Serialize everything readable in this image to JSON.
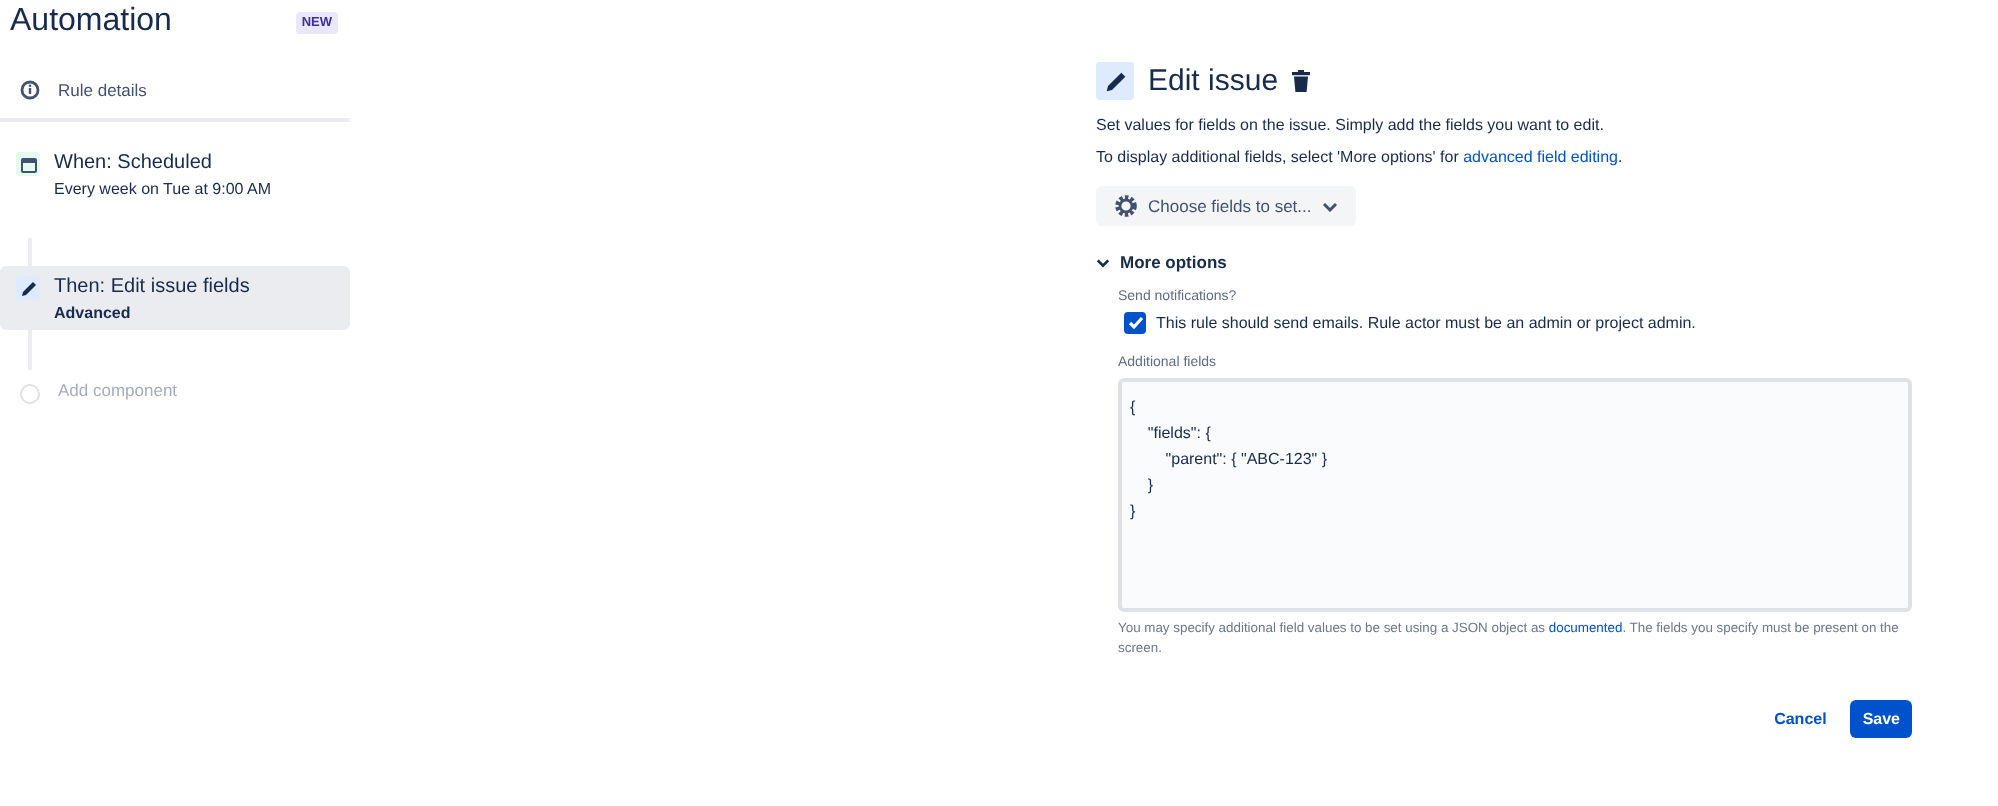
{
  "sidebar": {
    "title": "Automation",
    "badge": "NEW",
    "rule_details": "Rule details",
    "steps": [
      {
        "kind": "trigger",
        "title": "When: Scheduled",
        "subtitle": "Every week on Tue at 9:00 AM",
        "selected": false
      },
      {
        "kind": "action",
        "title": "Then: Edit issue fields",
        "subtitle": "Advanced",
        "selected": true
      },
      {
        "kind": "add",
        "title": "Add component",
        "selected": false
      }
    ]
  },
  "panel": {
    "title": "Edit issue",
    "description": "Set values for fields on the issue. Simply add the fields you want to edit.",
    "hint": {
      "before": "To display additional fields, select 'More options' for ",
      "link": "advanced field editing",
      "after": "."
    },
    "choose_button": "Choose fields to set...",
    "more_options": {
      "label": "More options",
      "expanded": true,
      "notifications_label": "Send notifications?",
      "notify": {
        "label": "This rule should send emails. Rule actor must be an admin or project admin.",
        "checked": true
      },
      "additional_label": "Additional fields",
      "additional_value": "{\n    \"fields\": {\n        \"parent\": { \"ABC-123\" }\n    }\n}",
      "help": {
        "before": "You may specify additional field values to be set using a JSON object as ",
        "link": "documented",
        "after": ". The fields you specify must be present on the screen."
      }
    },
    "buttons": [
      {
        "kind": "subtle",
        "label": "Cancel"
      },
      {
        "kind": "primary",
        "label": "Save"
      }
    ]
  }
}
